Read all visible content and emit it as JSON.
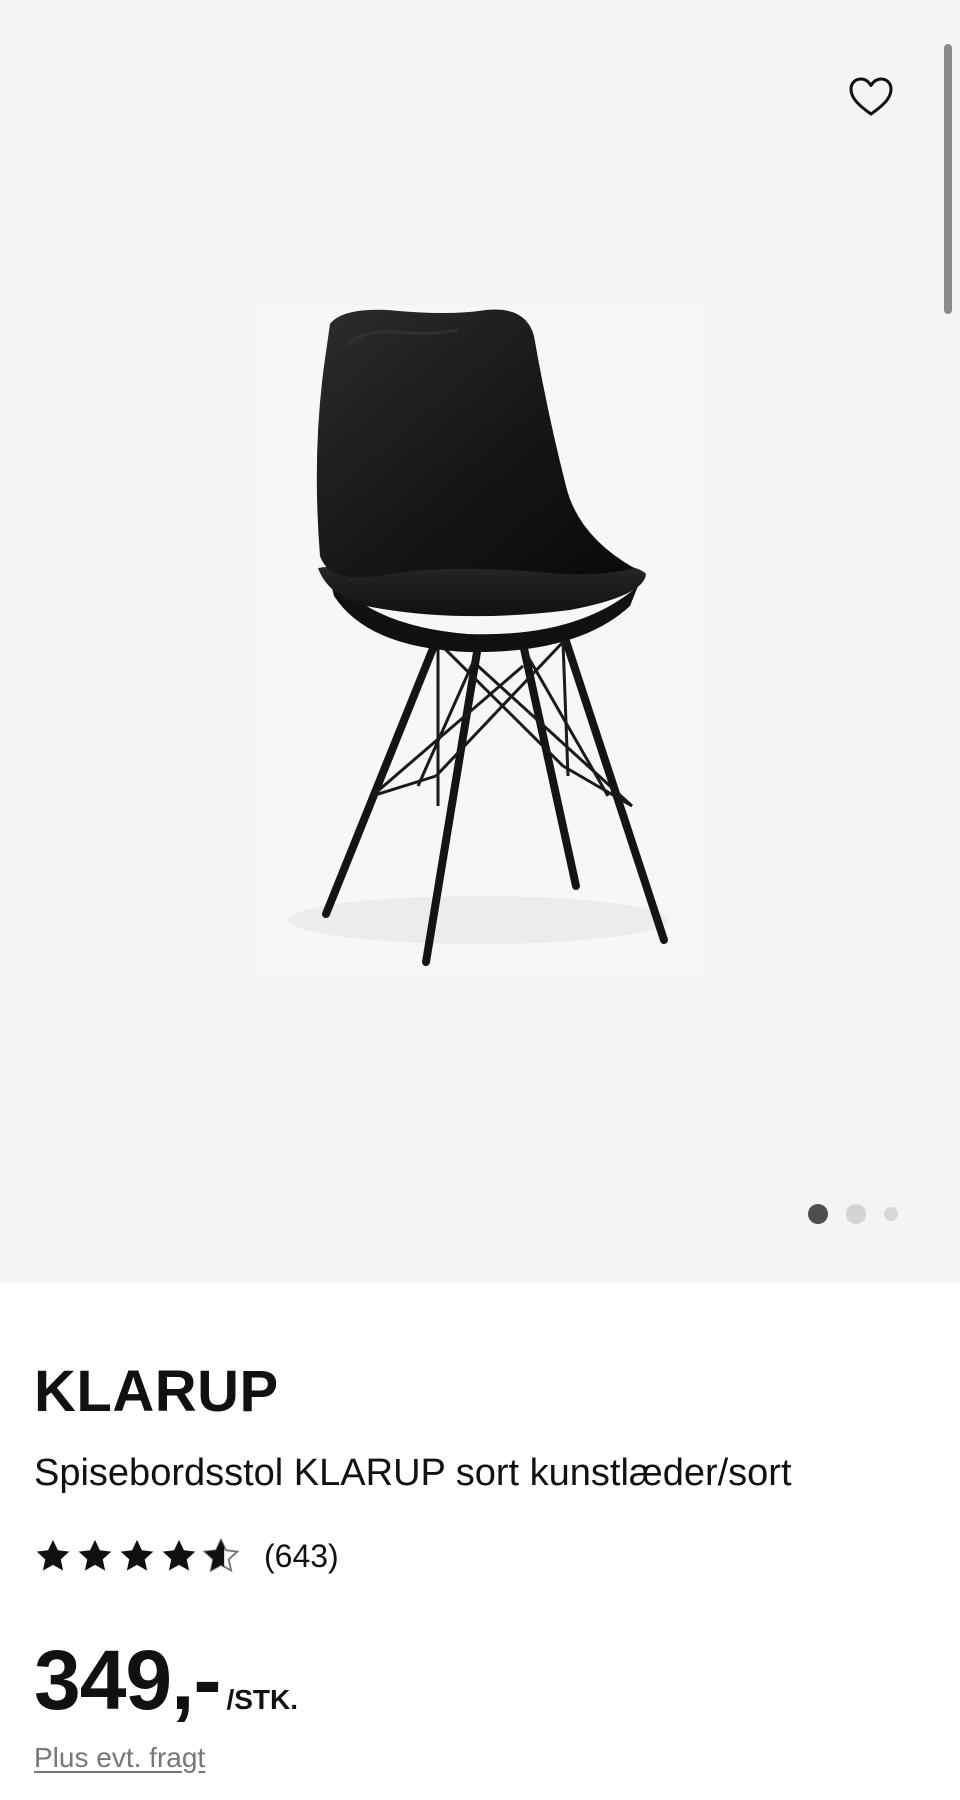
{
  "gallery": {
    "image_alt": "Spisebordsstol KLARUP sort kunstlæder/sort",
    "favorite_icon": "heart-outline-icon",
    "current_slide": 1,
    "slide_count": 3
  },
  "product": {
    "brand": "KLARUP",
    "name": "Spisebordsstol KLARUP sort kunstlæder/sort",
    "rating": 4.5,
    "rating_max": 5,
    "review_count": "(643)",
    "price": "349,-",
    "price_unit": "/STK.",
    "shipping": "Plus evt. fragt"
  },
  "colors": {
    "gallery_background": "#f4f4f4",
    "text": "#111111",
    "muted_text": "#777777",
    "active_dot": "#4e4e4e",
    "inactive_dot": "#d4d4d4"
  }
}
